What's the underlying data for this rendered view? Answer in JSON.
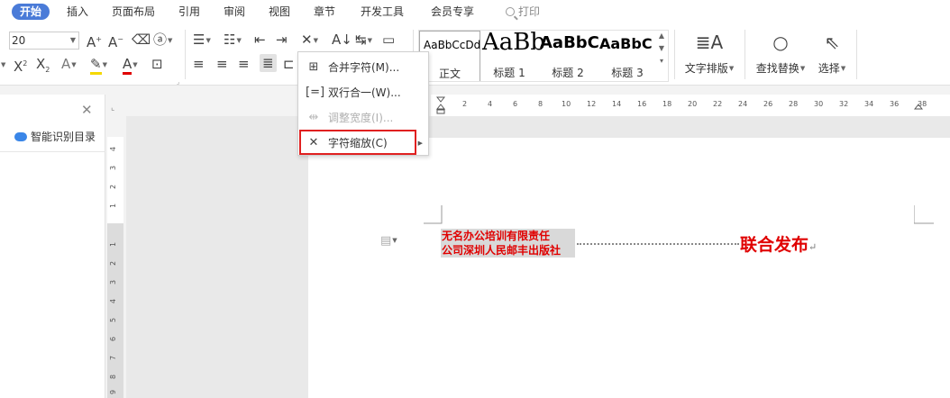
{
  "tabs": [
    "开始",
    "插入",
    "页面布局",
    "引用",
    "审阅",
    "视图",
    "章节",
    "开发工具",
    "会员专享"
  ],
  "search_label": "打印",
  "font_size": "20",
  "styles": [
    {
      "sample": "AaBbCcDd",
      "label": "正文"
    },
    {
      "sample": "AaBb",
      "label": "标题 1"
    },
    {
      "sample": "AaBbC",
      "label": "标题 2"
    },
    {
      "sample": "AaBbC",
      "label": "标题 3"
    }
  ],
  "big_buttons": {
    "text_layout": "文字排版",
    "find_replace": "查找替换",
    "select": "选择"
  },
  "menu": {
    "items": [
      {
        "label": "合并字符(M)...",
        "icon": "merge-chars-icon",
        "disabled": false
      },
      {
        "label": "双行合一(W)...",
        "icon": "two-lines-in-one-icon",
        "disabled": false
      },
      {
        "label": "调整宽度(I)...",
        "icon": "adjust-width-icon",
        "disabled": true
      },
      {
        "label": "字符缩放(C)",
        "icon": "char-scale-icon",
        "disabled": false,
        "submenu": true
      }
    ],
    "highlight_color": "#e02020"
  },
  "nav_pane": {
    "smart_toc": "智能识别目录"
  },
  "hruler_numbers": [
    "2",
    "4",
    "6",
    "8",
    "10",
    "12",
    "14",
    "16",
    "18",
    "20",
    "22",
    "24",
    "26",
    "28",
    "30",
    "32",
    "34",
    "36",
    "38"
  ],
  "vruler_numbers": [
    "4",
    "3",
    "2",
    "1",
    "1",
    "2",
    "3",
    "4",
    "5",
    "6",
    "7",
    "8",
    "9"
  ],
  "document": {
    "combined_line1": "无名办公培训有限责任",
    "combined_line2": "公司深圳人民邮丰出版社",
    "publish": "联合发布",
    "text_color": "#e00000"
  },
  "colors": {
    "active_tab": "#4a7bd8"
  }
}
